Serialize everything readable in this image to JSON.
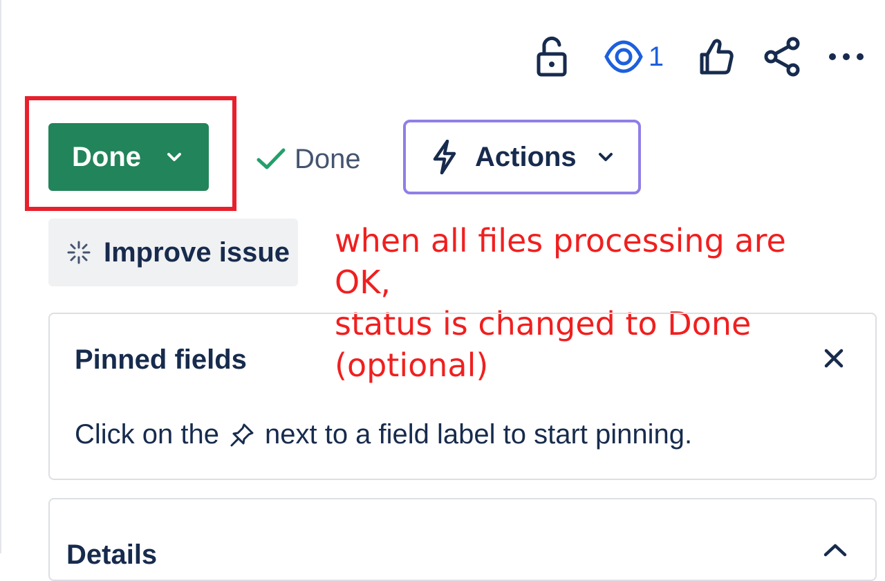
{
  "toolbar": {
    "lock_icon": "lock-open-icon",
    "watch_icon": "eye-icon",
    "watch_count": "1",
    "like_icon": "thumbs-up-icon",
    "share_icon": "share-icon",
    "more_icon": "more-horizontal-icon"
  },
  "status": {
    "button_label": "Done",
    "resolution_label": "Done",
    "highlight_color": "#e8202c",
    "button_color": "#22845a"
  },
  "actions": {
    "label": "Actions",
    "border_color": "#8f7ee7"
  },
  "improve": {
    "label": "Improve issue"
  },
  "annotation": {
    "lines": [
      "when all files processing are OK,",
      "status is changed to Done",
      "(optional)"
    ],
    "color": "#f01f1f"
  },
  "pinned_fields": {
    "title": "Pinned fields",
    "hint_before": "Click on the",
    "hint_after": "next to a field label to start pinning."
  },
  "details": {
    "title": "Details"
  }
}
